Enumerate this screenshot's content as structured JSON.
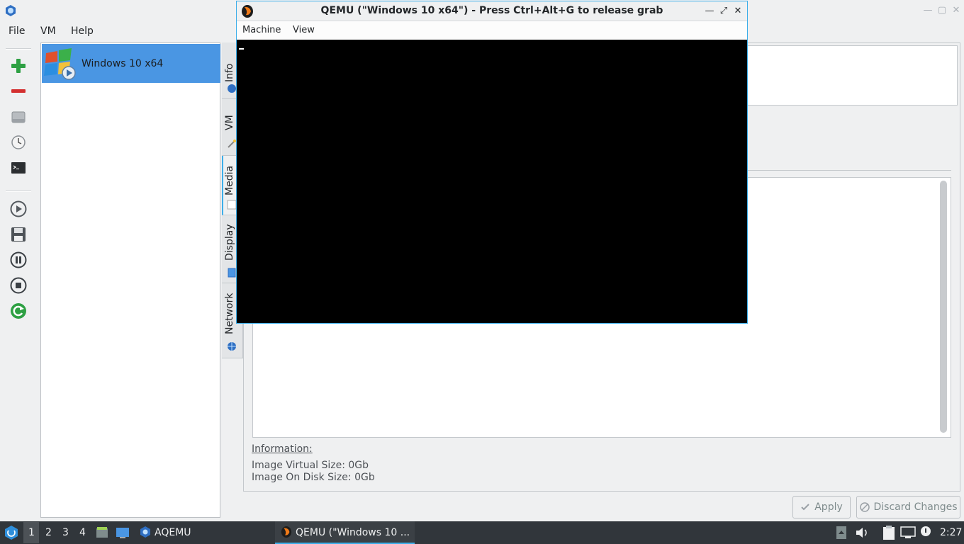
{
  "aqemu": {
    "menus": [
      "File",
      "VM",
      "Help"
    ],
    "toolbar": [
      {
        "name": "add-vm-icon"
      },
      {
        "name": "remove-vm-icon"
      },
      {
        "name": "disk-icon"
      },
      {
        "name": "clock-icon"
      },
      {
        "name": "terminal-icon"
      },
      {
        "name": "start-icon"
      },
      {
        "name": "save-icon"
      },
      {
        "name": "pause-icon"
      },
      {
        "name": "stop-icon"
      },
      {
        "name": "reset-icon"
      }
    ],
    "vm_list": [
      {
        "label": "Windows 10 x64",
        "selected": true
      }
    ],
    "tabs": [
      "Info",
      "VM",
      "Media",
      "Display",
      "Network"
    ],
    "active_tab": "Media",
    "info": {
      "heading": "Information:",
      "virtual_size": "Image Virtual Size: 0Gb",
      "disk_size": "Image On Disk Size: 0Gb"
    },
    "buttons": {
      "apply": "Apply",
      "discard": "Discard Changes"
    }
  },
  "qemu": {
    "title": "QEMU (\"Windows 10 x64\") - Press Ctrl+Alt+G to release grab",
    "menus": [
      "Machine",
      "View"
    ]
  },
  "taskbar": {
    "workspaces": [
      "1",
      "2",
      "3",
      "4"
    ],
    "active_workspace": "1",
    "tasks": [
      "AQEMU",
      "QEMU (\"Windows 10 ..."
    ],
    "clock": "2:27"
  },
  "colors": {
    "accent": "#3daee9",
    "selection": "#4a96e3",
    "taskbar": "#31363b"
  }
}
